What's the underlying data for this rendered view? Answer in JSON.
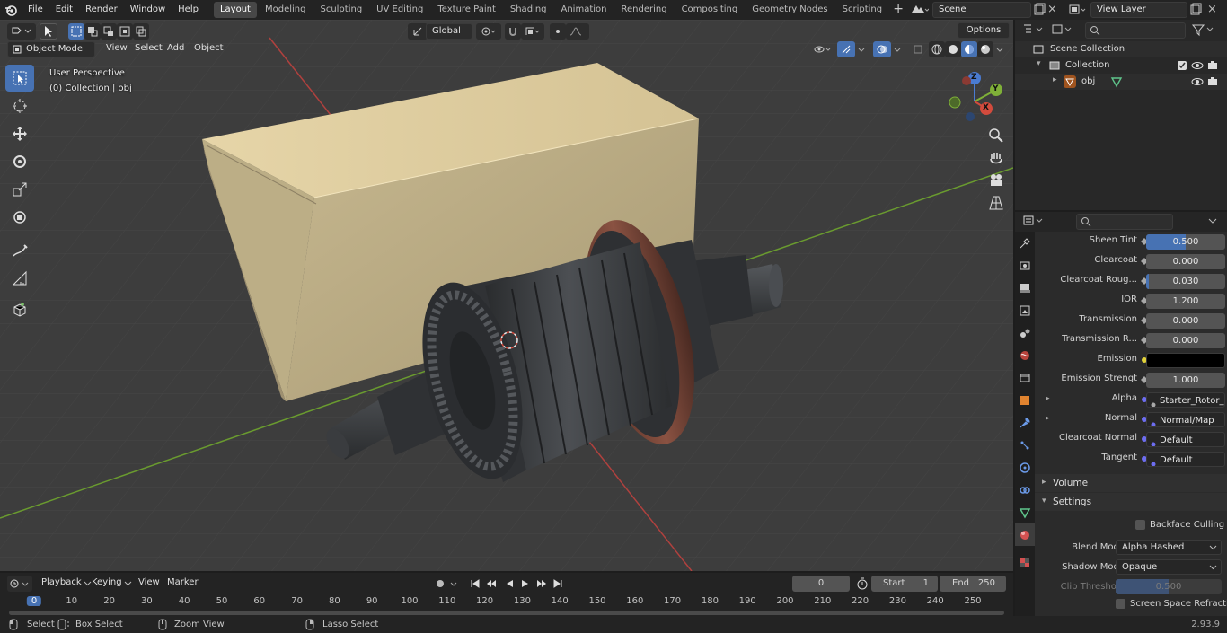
{
  "menubar": {
    "items": [
      "File",
      "Edit",
      "Render",
      "Window",
      "Help"
    ],
    "workspaces": [
      "Layout",
      "Modeling",
      "Sculpting",
      "UV Editing",
      "Texture Paint",
      "Shading",
      "Animation",
      "Rendering",
      "Compositing",
      "Geometry Nodes",
      "Scripting"
    ],
    "active_workspace": "Layout",
    "scene": "Scene",
    "view_layer": "View Layer"
  },
  "viewport": {
    "mode": "Object Mode",
    "menus": [
      "View",
      "Select",
      "Add",
      "Object"
    ],
    "transform_orientation": "Global",
    "options_label": "Options",
    "perspective_label": "User Perspective",
    "collection_label": "(0) Collection | obj",
    "gizmo": {
      "x": "X",
      "y": "Y",
      "z": "Z"
    }
  },
  "outliner": {
    "scene_collection": "Scene Collection",
    "collection": "Collection",
    "object": "obj"
  },
  "properties": {
    "rows": [
      {
        "label": "Sheen Tint",
        "value": "0.500",
        "fill": 0.5
      },
      {
        "label": "Clearcoat",
        "value": "0.000",
        "fill": 0
      },
      {
        "label": "Clearcoat Roug...",
        "value": "0.030",
        "fill": 0.03
      },
      {
        "label": "IOR",
        "value": "1.200",
        "fill": 0
      },
      {
        "label": "Transmission",
        "value": "0.000",
        "fill": 0
      },
      {
        "label": "Transmission R...",
        "value": "0.000",
        "fill": 0
      },
      {
        "label": "Emission",
        "value": "",
        "fill": 0
      },
      {
        "label": "Emission Strengt",
        "value": "1.000",
        "fill": 0
      },
      {
        "label": "Alpha",
        "value": "Starter_Rotor_Refra...",
        "fill": 0
      },
      {
        "label": "Normal",
        "value": "Normal/Map",
        "fill": 0
      },
      {
        "label": "Clearcoat Normal",
        "value": "Default",
        "fill": 0
      },
      {
        "label": "Tangent",
        "value": "Default",
        "fill": 0
      }
    ],
    "sections": {
      "volume": "Volume",
      "settings": "Settings"
    },
    "backface_culling": "Backface Culling",
    "blend_mode_label": "Blend Mode",
    "blend_mode_value": "Alpha Hashed",
    "shadow_mode_label": "Shadow Mode",
    "shadow_mode_value": "Opaque",
    "clip_threshold_label": "Clip Threshold",
    "clip_threshold_value": "0.500",
    "ssr_label": "Screen Space Refraction"
  },
  "timeline": {
    "menus": [
      "Playback",
      "Keying",
      "View",
      "Marker"
    ],
    "current_frame": "0",
    "start_label": "Start",
    "start_value": "1",
    "end_label": "End",
    "end_value": "250",
    "ticks": [
      "0",
      "10",
      "20",
      "30",
      "40",
      "50",
      "60",
      "70",
      "80",
      "90",
      "100",
      "110",
      "120",
      "130",
      "140",
      "150",
      "160",
      "170",
      "180",
      "190",
      "200",
      "210",
      "220",
      "230",
      "240",
      "250"
    ]
  },
  "statusbar": {
    "select": "Select",
    "box_select": "Box Select",
    "zoom_view": "Zoom View",
    "lasso_select": "Lasso Select",
    "version": "2.93.9"
  },
  "colors": {
    "accent": "#4772b3",
    "viewport_bg": "#3d3d3d",
    "x_axis": "#b0413e",
    "y_axis": "#6a9b2f"
  }
}
